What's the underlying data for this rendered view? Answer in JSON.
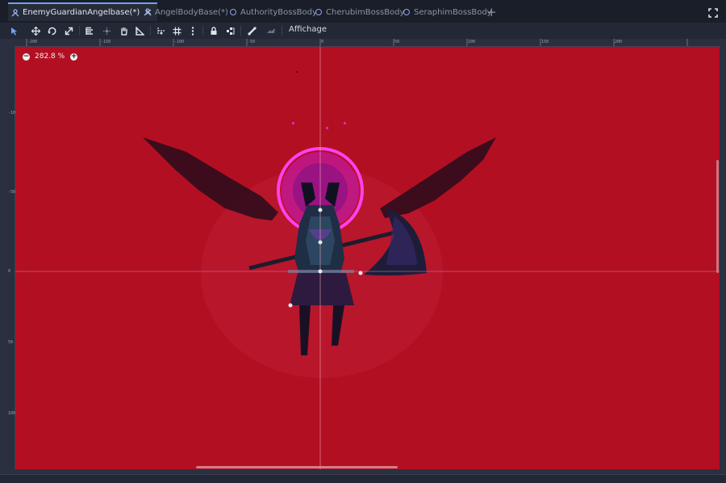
{
  "tabs": [
    {
      "label": "EnemyGuardianAngelbase(*)",
      "icon": "scene-node-icon",
      "active": true,
      "closable": true
    },
    {
      "label": "AngelBodyBase(*)",
      "icon": "scene-node-icon",
      "active": false
    },
    {
      "label": "AuthorityBossBody",
      "icon": "scene-ring-icon",
      "active": false
    },
    {
      "label": "CherubimBossBody",
      "icon": "scene-ring-icon",
      "active": false
    },
    {
      "label": "SeraphimBossBody",
      "icon": "scene-ring-icon",
      "active": false
    }
  ],
  "tab_close_symbol": "✕",
  "add_tab_symbol": "+",
  "toolbar": {
    "view_menu_label": "Affichage",
    "tools": [
      "select-tool-icon",
      "move-tool-icon",
      "rotate-tool-icon",
      "scale-tool-icon",
      "list-select-icon",
      "pivot-icon",
      "pan-icon",
      "ruler-icon",
      "smart-snap-icon",
      "grid-snap-icon",
      "more-icon",
      "lock-icon",
      "group-icon",
      "bone-icon",
      "skeleton-icon"
    ]
  },
  "viewport": {
    "zoom_out": "−",
    "zoom_level": "282.8 %",
    "zoom_in": "+",
    "canvas_color": "#b30f22",
    "ruler_top_ticks": [
      "-200",
      "-150",
      "-100",
      "-50",
      "0",
      "50",
      "100",
      "150",
      "200"
    ],
    "ruler_left_ticks": [
      "-100",
      "-50",
      "0",
      "50",
      "100"
    ]
  },
  "colors": {
    "accent": "#6ea2f0",
    "halo": "#e02cd8",
    "wing": "#2a1020"
  }
}
